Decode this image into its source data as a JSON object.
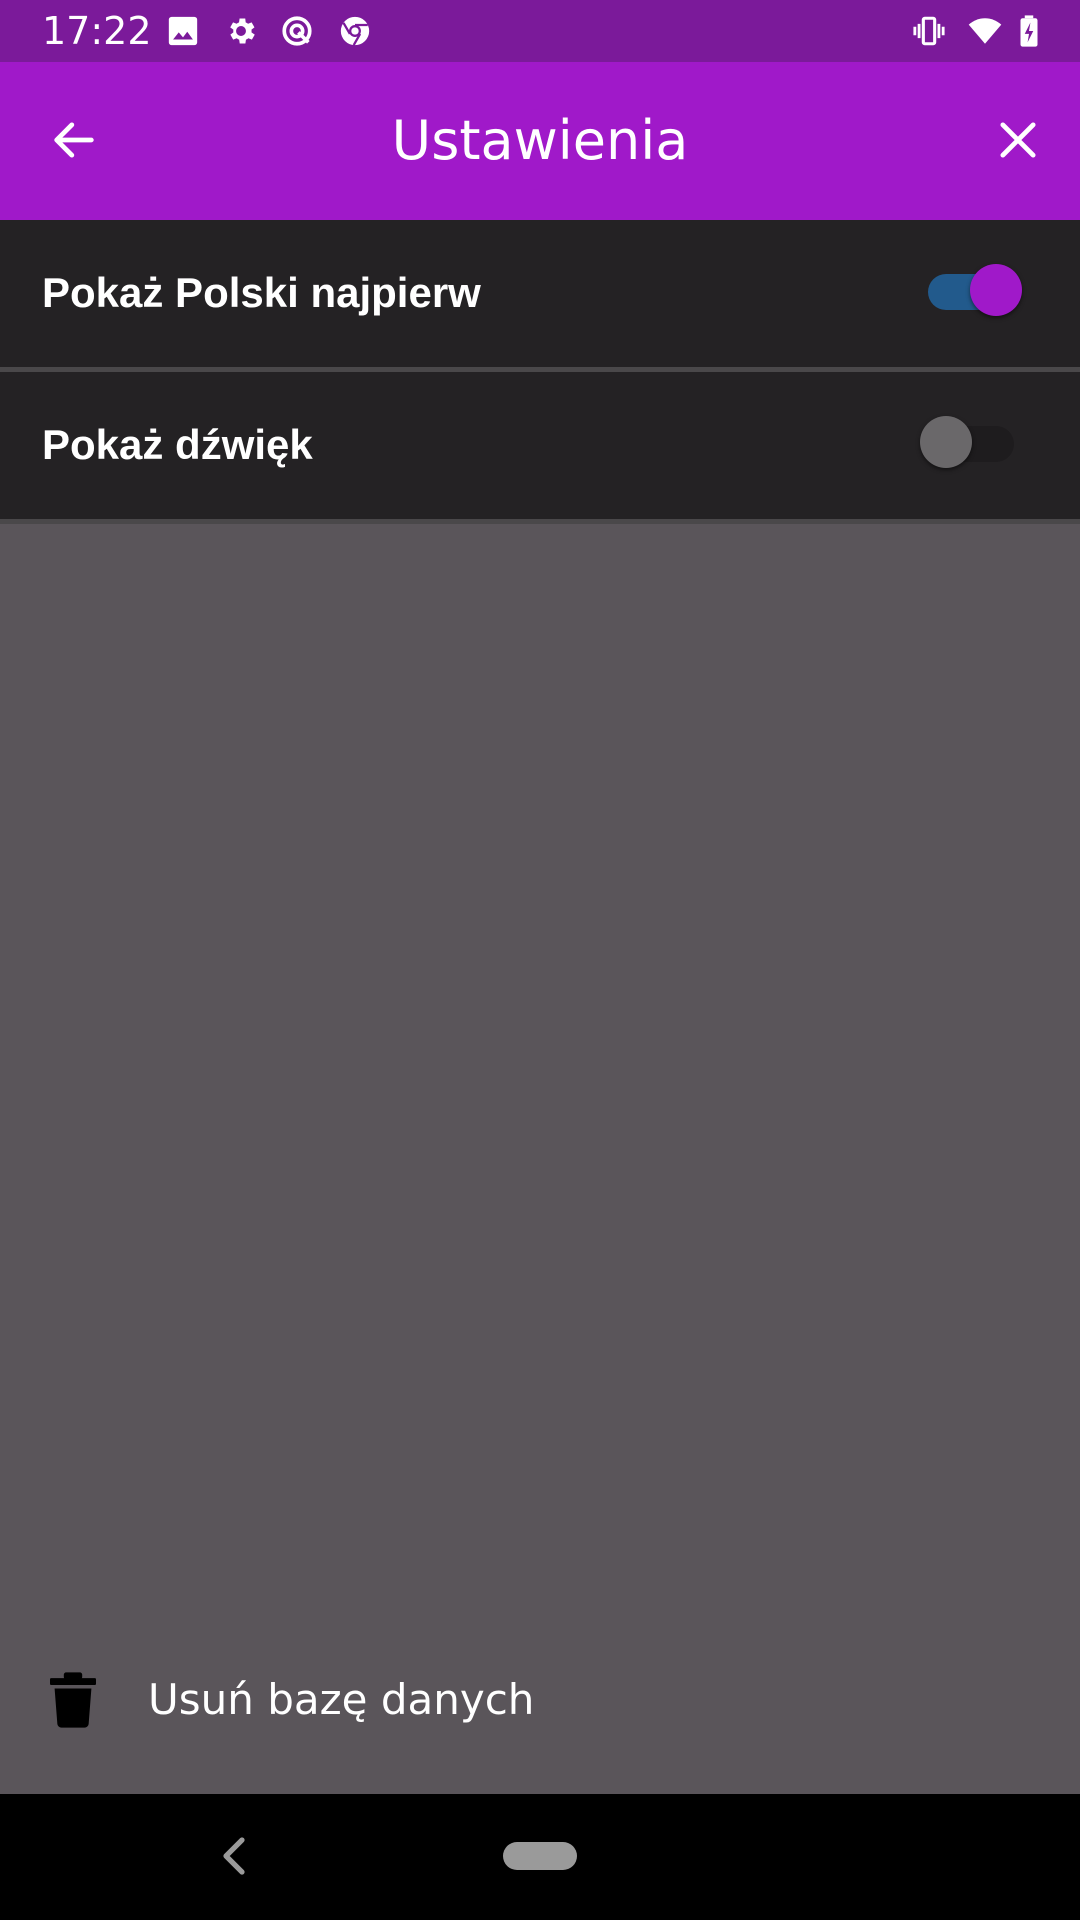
{
  "status_bar": {
    "time": "17:22",
    "left_icons": [
      "image-icon",
      "gear-icon",
      "assistant-icon",
      "chrome-icon"
    ],
    "right_icons": [
      "vibrate-icon",
      "wifi-icon",
      "battery-charging-icon"
    ],
    "background": "#7b1a9a"
  },
  "app_bar": {
    "title": "Ustawienia",
    "back_icon": "arrow-left-icon",
    "close_icon": "close-icon",
    "background": "#a019c9"
  },
  "settings": {
    "items": [
      {
        "label": "Pokaż Polski najpierw",
        "enabled": true
      },
      {
        "label": "Pokaż dźwięk",
        "enabled": false
      }
    ]
  },
  "actions": {
    "delete_database_label": "Usuń bazę danych",
    "delete_icon": "trash-icon"
  },
  "colors": {
    "accent": "#a019c9",
    "switch_track_on": "#225a8c",
    "row_background": "#242224",
    "page_background": "#5a555a"
  },
  "nav_bar": {
    "back_icon": "nav-back-icon",
    "home_icon": "nav-home-pill"
  }
}
